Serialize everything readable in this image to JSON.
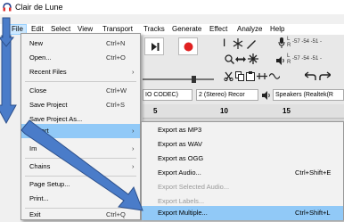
{
  "window": {
    "title": "Clair de Lune"
  },
  "menubar": {
    "items": [
      "File",
      "Edit",
      "Select",
      "View",
      "Transport",
      "Tracks",
      "Generate",
      "Effect",
      "Analyze",
      "Help"
    ]
  },
  "toolbar": {
    "meter_top": "-57 -54 -51 -",
    "meter_bottom": "-57 -54 -51 -",
    "meter_channel_l": "L",
    "meter_channel_r": "R",
    "host_partial": "IO CODEC)",
    "channels": "2 (Stereo) Recor",
    "output_device": "Speakers (Realtek(R",
    "mic_icon": "microphone-icon",
    "speaker_icon": "speaker-icon"
  },
  "ruler": {
    "ticks": [
      "5",
      "10",
      "15"
    ]
  },
  "file_menu": {
    "items": [
      {
        "label": "New",
        "shortcut": "Ctrl+N"
      },
      {
        "label": "Open...",
        "shortcut": "Ctrl+O"
      },
      {
        "label": "Recent Files",
        "submenu": "›"
      },
      {
        "label": "Close",
        "shortcut": "Ctrl+W"
      },
      {
        "label": "Save Project",
        "shortcut": "Ctrl+S"
      },
      {
        "label": "Save Project As...",
        "shortcut": ""
      },
      {
        "label": "Export",
        "submenu": "›"
      },
      {
        "label": "Im",
        "submenu": "›"
      },
      {
        "label": "Chains",
        "submenu": "›"
      },
      {
        "label": "Page Setup...",
        "shortcut": ""
      },
      {
        "label": "Print...",
        "shortcut": ""
      },
      {
        "label": "Exit",
        "shortcut": "Ctrl+Q"
      }
    ]
  },
  "export_menu": {
    "items": [
      {
        "label": "Export as MP3",
        "shortcut": ""
      },
      {
        "label": "Export as WAV",
        "shortcut": ""
      },
      {
        "label": "Export as OGG",
        "shortcut": ""
      },
      {
        "label": "Export Audio...",
        "shortcut": "Ctrl+Shift+E"
      },
      {
        "label": "Export Selected Audio...",
        "shortcut": ""
      },
      {
        "label": "Export Labels...",
        "shortcut": ""
      },
      {
        "label": "Export Multiple...",
        "shortcut": "Ctrl+Shift+L"
      }
    ]
  },
  "colors": {
    "menu_highlight": "#91c9f7",
    "arrow_fill": "#4a7cc9",
    "arrow_stroke": "#2c4f8a",
    "record_red": "#e02020"
  }
}
